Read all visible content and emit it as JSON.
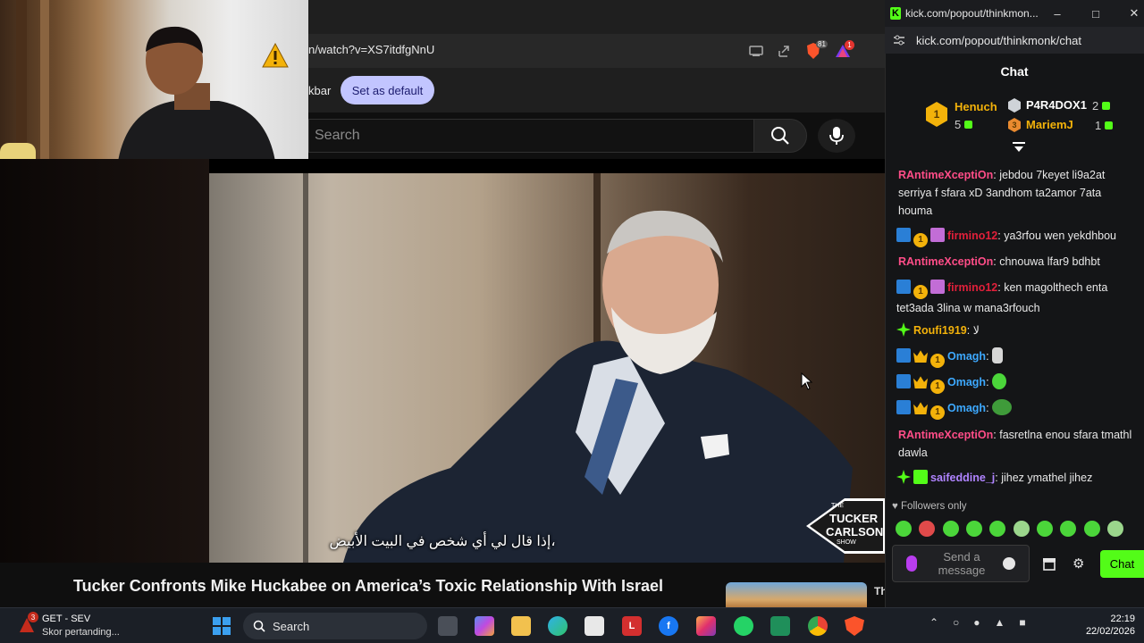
{
  "browser": {
    "address_url": "n/watch?v=XS7itdfgNnU",
    "notice_text": "kbar",
    "set_default_label": "Set as default",
    "shield_count": "81",
    "alert_count": "1"
  },
  "youtube": {
    "search_placeholder": "Search",
    "subtitle": "إذا قال لي أي شخص في البيت الأبيض،",
    "video_title": "Tucker Confronts Mike Huckabee on America’s Toxic Relationship With Israel",
    "logo_lines": [
      "THE",
      "TUCKER",
      "CARLSON",
      "SHOW"
    ],
    "recommended_title": "The New Pyramid Theory Explains the Missing Evidence"
  },
  "chat_popup": {
    "window_title": "kick.com/popout/thinkmon...",
    "url": "kick.com/popout/thinkmonk/chat",
    "heading": "Chat",
    "leaderboard": [
      {
        "rank": "1",
        "name": "Henuch",
        "count": "5",
        "color": "#f3b20a"
      },
      {
        "rank": "",
        "name": "P4R4DOX1",
        "count": "2",
        "color": "#ffffff"
      },
      {
        "rank": "3",
        "name": "MariemJ",
        "count": "1",
        "color": "#f3b20a"
      }
    ],
    "messages": [
      {
        "user": "RAntimeXceptiOn",
        "color": "#ff4d88",
        "text": " jebdou 7keyet li9a2at serriya f sfara xD 3andhom ta2amor 7ata houma"
      },
      {
        "user": "firmino12",
        "color": "#e0203a",
        "text": " ya3rfou wen yekdhbou"
      },
      {
        "user": "RAntimeXceptiOn",
        "color": "#ff4d88",
        "text": " chnouwa lfar9 bdhbt"
      },
      {
        "user": "firmino12",
        "color": "#e0203a",
        "text": " ken magolthech enta tet3ada 3lina w mana3rfouch"
      },
      {
        "user": "Roufi1919",
        "color": "#f3b20a",
        "text": " لا"
      },
      {
        "user": "Omagh",
        "color": "#3da9ff",
        "text": ""
      },
      {
        "user": "Omagh",
        "color": "#3da9ff",
        "text": ""
      },
      {
        "user": "Omagh",
        "color": "#3da9ff",
        "text": ""
      },
      {
        "user": "RAntimeXceptiOn",
        "color": "#ff4d88",
        "text": " fasretlna enou sfara tmathl dawla"
      },
      {
        "user": "saifeddine_j",
        "color": "#b084ff",
        "text": " jihez ymathel jihez"
      }
    ],
    "followers_only": "Followers only",
    "input_placeholder": "Send a message",
    "send_label": "Chat",
    "accent": "#53fc18"
  },
  "taskbar": {
    "widget_badge": "3",
    "widget_title": "GET - SEV",
    "widget_subtitle": "Skor pertanding...",
    "search_label": "Search",
    "time": "22:19",
    "date": "22/02/2026"
  }
}
